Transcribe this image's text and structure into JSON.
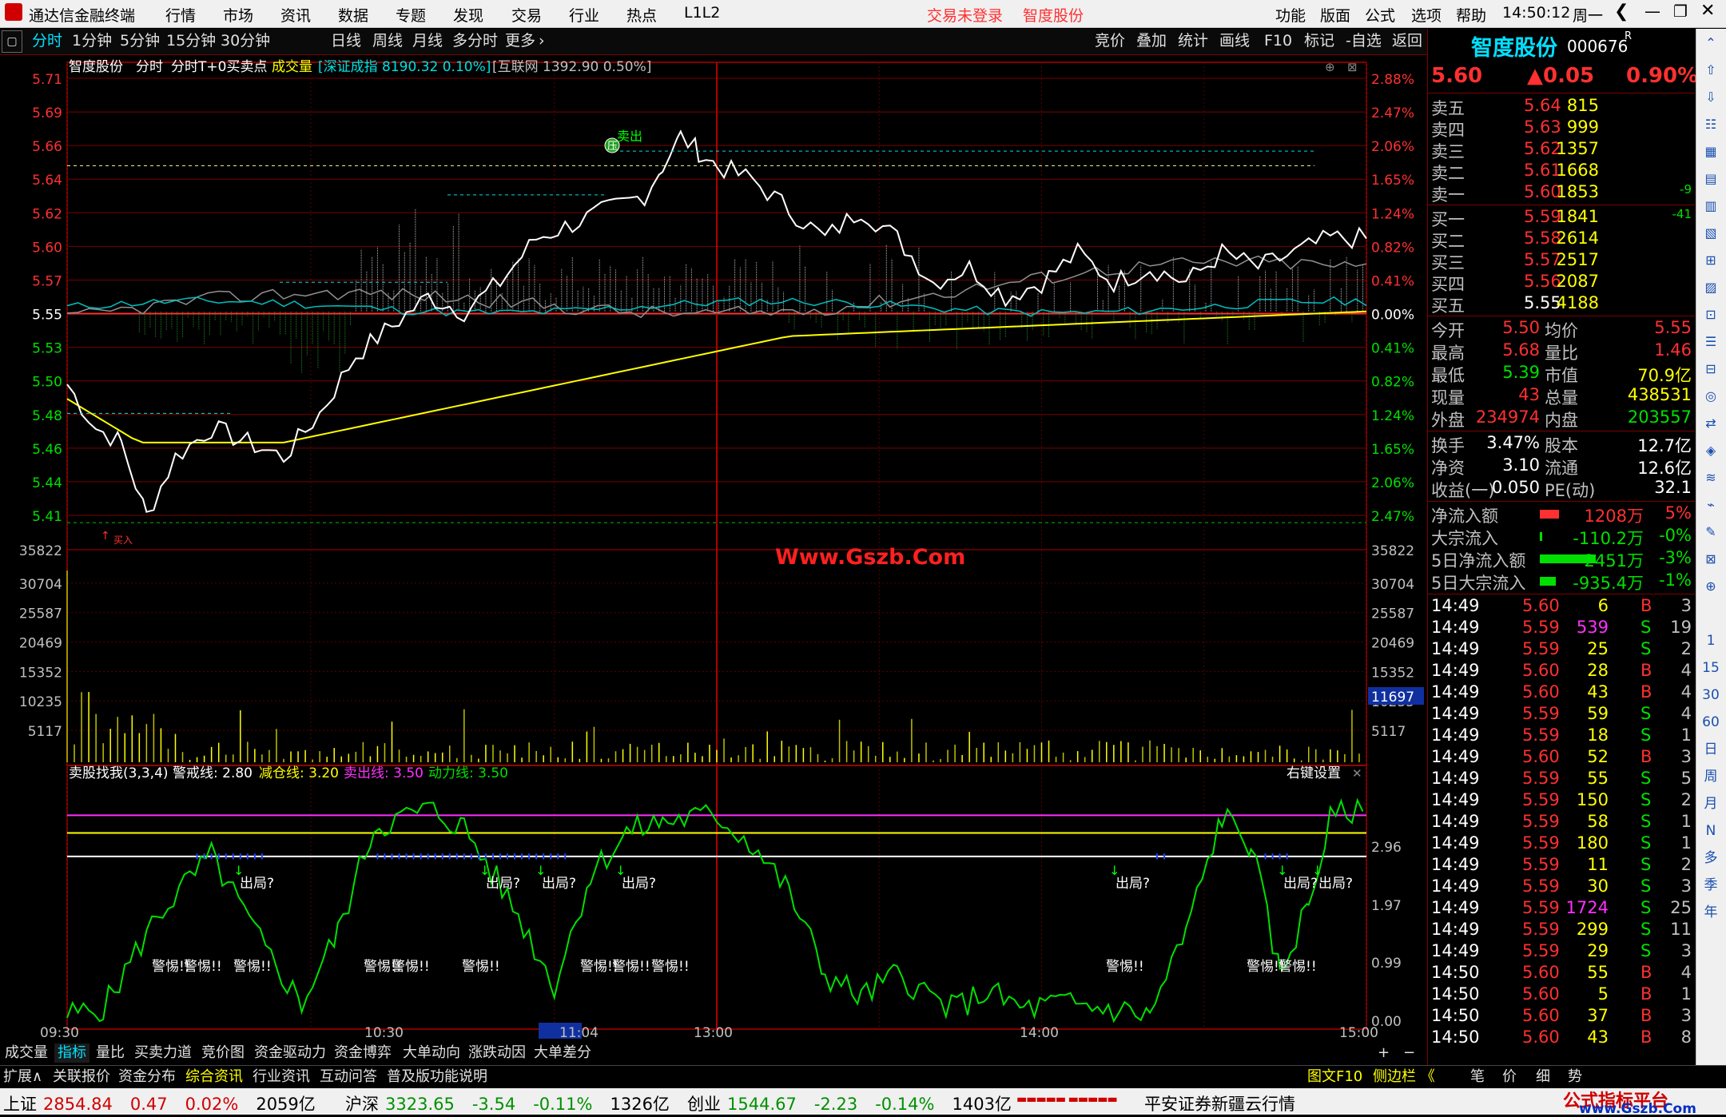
{
  "titlebar": {
    "app_title": "通达信金融终端",
    "menu": [
      "行情",
      "市场",
      "资讯",
      "数据",
      "专题",
      "发现",
      "交易",
      "行业",
      "热点",
      "L1L2"
    ],
    "login_status": "交易未登录",
    "stock_name": "智度股份",
    "right_menu": [
      "功能",
      "版面",
      "公式",
      "选项",
      "帮助"
    ],
    "time": "14:50:12",
    "weekday": "周一"
  },
  "period_tabs": [
    "分时",
    "1分钟",
    "5分钟",
    "15分钟",
    "30分钟",
    "日线",
    "周线",
    "月线",
    "多分时",
    "更多"
  ],
  "period_active": "分时",
  "tool_tabs": [
    "竞价",
    "叠加",
    "统计",
    "画线",
    "F10",
    "标记",
    "-自选",
    "返回"
  ],
  "chart_header": {
    "stock": "智度股份",
    "mode": "分时",
    "indicator": "分时T+0买卖点",
    "volume_label": "成交量",
    "index1": "[深证成指 8190.32 0.10%]",
    "index2": "[互联网 1392.90 0.50%]"
  },
  "price_axis": {
    "left": [
      "5.71",
      "5.69",
      "5.66",
      "5.64",
      "5.62",
      "5.60",
      "5.57",
      "5.55",
      "5.53",
      "5.50",
      "5.48",
      "5.46",
      "5.44",
      "5.41"
    ],
    "right": [
      "2.88%",
      "2.47%",
      "2.06%",
      "1.65%",
      "1.24%",
      "0.82%",
      "0.41%",
      "0.00%",
      "0.41%",
      "0.82%",
      "1.24%",
      "1.65%",
      "2.06%",
      "2.47%"
    ]
  },
  "volume_axis": [
    "35822",
    "30704",
    "25587",
    "20469",
    "15352",
    "10235",
    "5117"
  ],
  "volume_current": "11697",
  "watermark": "Www.Gszb.Com",
  "markers": {
    "sell": "卖出",
    "press": "压",
    "buy": "买入"
  },
  "indicator_header": {
    "name": "卖股找我(3,3,4)",
    "l1": "警戒线: 2.80",
    "l2": "减仓线: 3.20",
    "l3": "卖出线: 3.50",
    "l4": "动力线: 3.50",
    "settings": "右键设置"
  },
  "indicator_axis": [
    "2.96",
    "1.97",
    "0.99",
    "0.00"
  ],
  "indicator_labels": {
    "exit": "出局?",
    "alert": "警惕!!"
  },
  "time_axis": [
    "09:30",
    "10:30",
    "11:04",
    "13:00",
    "14:00",
    "15:00"
  ],
  "bottom_tabs": [
    "成交量",
    "指标",
    "量比",
    "买卖力道",
    "竞价图",
    "资金驱动力",
    "资金博弈",
    "大单动向",
    "涨跌动因",
    "大单差分"
  ],
  "bottom_active": "指标",
  "bottom_tabs2": [
    "扩展∧",
    "关联报价",
    "资金分布",
    "综合资讯",
    "行业资讯",
    "互动问答",
    "普及版功能说明"
  ],
  "bottom_right": [
    "图文F10",
    "侧边栏 《",
    "笔",
    "价",
    "细",
    "势"
  ],
  "quote": {
    "name": "智度股份",
    "code": "000676",
    "flag": "R",
    "price": "5.60",
    "change": "▲0.05",
    "pct": "0.90%",
    "asks": [
      {
        "label": "卖五",
        "price": "5.64",
        "vol": "815",
        "chg": ""
      },
      {
        "label": "卖四",
        "price": "5.63",
        "vol": "999",
        "chg": ""
      },
      {
        "label": "卖三",
        "price": "5.62",
        "vol": "1357",
        "chg": ""
      },
      {
        "label": "卖二",
        "price": "5.61",
        "vol": "1668",
        "chg": ""
      },
      {
        "label": "卖一",
        "price": "5.60",
        "vol": "1853",
        "chg": "-9"
      }
    ],
    "bids": [
      {
        "label": "买一",
        "price": "5.59",
        "vol": "1841",
        "chg": "-41"
      },
      {
        "label": "买二",
        "price": "5.58",
        "vol": "2614",
        "chg": ""
      },
      {
        "label": "买三",
        "price": "5.57",
        "vol": "2517",
        "chg": ""
      },
      {
        "label": "买四",
        "price": "5.56",
        "vol": "2087",
        "chg": ""
      },
      {
        "label": "买五",
        "price": "5.55",
        "vol": "4188",
        "chg": ""
      }
    ],
    "stats": [
      {
        "k1": "今开",
        "v1": "5.50",
        "k2": "均价",
        "v2": "5.55"
      },
      {
        "k1": "最高",
        "v1": "5.68",
        "k2": "量比",
        "v2": "1.46"
      },
      {
        "k1": "最低",
        "v1": "5.39",
        "k2": "市值",
        "v2": "70.9亿"
      },
      {
        "k1": "现量",
        "v1": "43",
        "k2": "总量",
        "v2": "438531"
      },
      {
        "k1": "外盘",
        "v1": "234974",
        "k2": "内盘",
        "v2": "203557"
      }
    ],
    "stats2": [
      {
        "k1": "换手",
        "v1": "3.47%",
        "k2": "股本",
        "v2": "12.7亿"
      },
      {
        "k1": "净资",
        "v1": "3.10",
        "k2": "流通",
        "v2": "12.6亿"
      },
      {
        "k1": "收益(一)",
        "v1": "0.050",
        "k2": "PE(动)",
        "v2": "32.1"
      }
    ],
    "flows": [
      {
        "k": "净流入额",
        "v": "1208万",
        "p": "5%",
        "bar": 0.12,
        "dir": "in"
      },
      {
        "k": "大宗流入",
        "v": "-110.2万",
        "p": "-0%",
        "bar": 0.01,
        "dir": "out"
      },
      {
        "k": "5日净流入额",
        "v": "-2451万",
        "p": "-3%",
        "bar": 0.35,
        "dir": "out"
      },
      {
        "k": "5日大宗流入",
        "v": "-935.4万",
        "p": "-1%",
        "bar": 0.1,
        "dir": "out"
      }
    ],
    "ticks": [
      {
        "t": "14:49",
        "p": "5.60",
        "v": "6",
        "s": "B",
        "n": "3"
      },
      {
        "t": "14:49",
        "p": "5.59",
        "v": "539",
        "s": "S",
        "n": "19"
      },
      {
        "t": "14:49",
        "p": "5.59",
        "v": "25",
        "s": "S",
        "n": "2"
      },
      {
        "t": "14:49",
        "p": "5.60",
        "v": "28",
        "s": "B",
        "n": "4"
      },
      {
        "t": "14:49",
        "p": "5.60",
        "v": "43",
        "s": "B",
        "n": "4"
      },
      {
        "t": "14:49",
        "p": "5.59",
        "v": "59",
        "s": "S",
        "n": "4"
      },
      {
        "t": "14:49",
        "p": "5.59",
        "v": "18",
        "s": "S",
        "n": "1"
      },
      {
        "t": "14:49",
        "p": "5.60",
        "v": "52",
        "s": "B",
        "n": "3"
      },
      {
        "t": "14:49",
        "p": "5.59",
        "v": "55",
        "s": "S",
        "n": "5"
      },
      {
        "t": "14:49",
        "p": "5.59",
        "v": "150",
        "s": "S",
        "n": "2"
      },
      {
        "t": "14:49",
        "p": "5.59",
        "v": "58",
        "s": "S",
        "n": "1"
      },
      {
        "t": "14:49",
        "p": "5.59",
        "v": "180",
        "s": "S",
        "n": "1"
      },
      {
        "t": "14:49",
        "p": "5.59",
        "v": "11",
        "s": "S",
        "n": "2"
      },
      {
        "t": "14:49",
        "p": "5.59",
        "v": "30",
        "s": "S",
        "n": "3"
      },
      {
        "t": "14:49",
        "p": "5.59",
        "v": "1724",
        "s": "S",
        "n": "25"
      },
      {
        "t": "14:49",
        "p": "5.59",
        "v": "299",
        "s": "S",
        "n": "11"
      },
      {
        "t": "14:49",
        "p": "5.59",
        "v": "29",
        "s": "S",
        "n": "3"
      },
      {
        "t": "14:50",
        "p": "5.60",
        "v": "55",
        "s": "B",
        "n": "4"
      },
      {
        "t": "14:50",
        "p": "5.60",
        "v": "5",
        "s": "B",
        "n": "1"
      },
      {
        "t": "14:50",
        "p": "5.60",
        "v": "37",
        "s": "B",
        "n": "3"
      },
      {
        "t": "14:50",
        "p": "5.60",
        "v": "43",
        "s": "B",
        "n": "8"
      }
    ]
  },
  "side_icons": [
    "1",
    "15",
    "30",
    "60",
    "日",
    "周",
    "月",
    "N",
    "多",
    "季",
    "年"
  ],
  "statusbar": {
    "items": [
      {
        "name": "上证",
        "val": "2854.84",
        "chg": "0.47",
        "pct": "0.02%",
        "amt": "2059亿"
      },
      {
        "name": "沪深",
        "val": "3323.65",
        "chg": "-3.54",
        "pct": "-0.11%",
        "amt": "1326亿"
      },
      {
        "name": "创业",
        "val": "1544.67",
        "chg": "-2.23",
        "pct": "-0.14%",
        "amt": "1403亿"
      }
    ],
    "broker": "平安证券新疆云行情",
    "brand": "公式指标平台",
    "brand_url": "www.Gszb.Com"
  }
}
